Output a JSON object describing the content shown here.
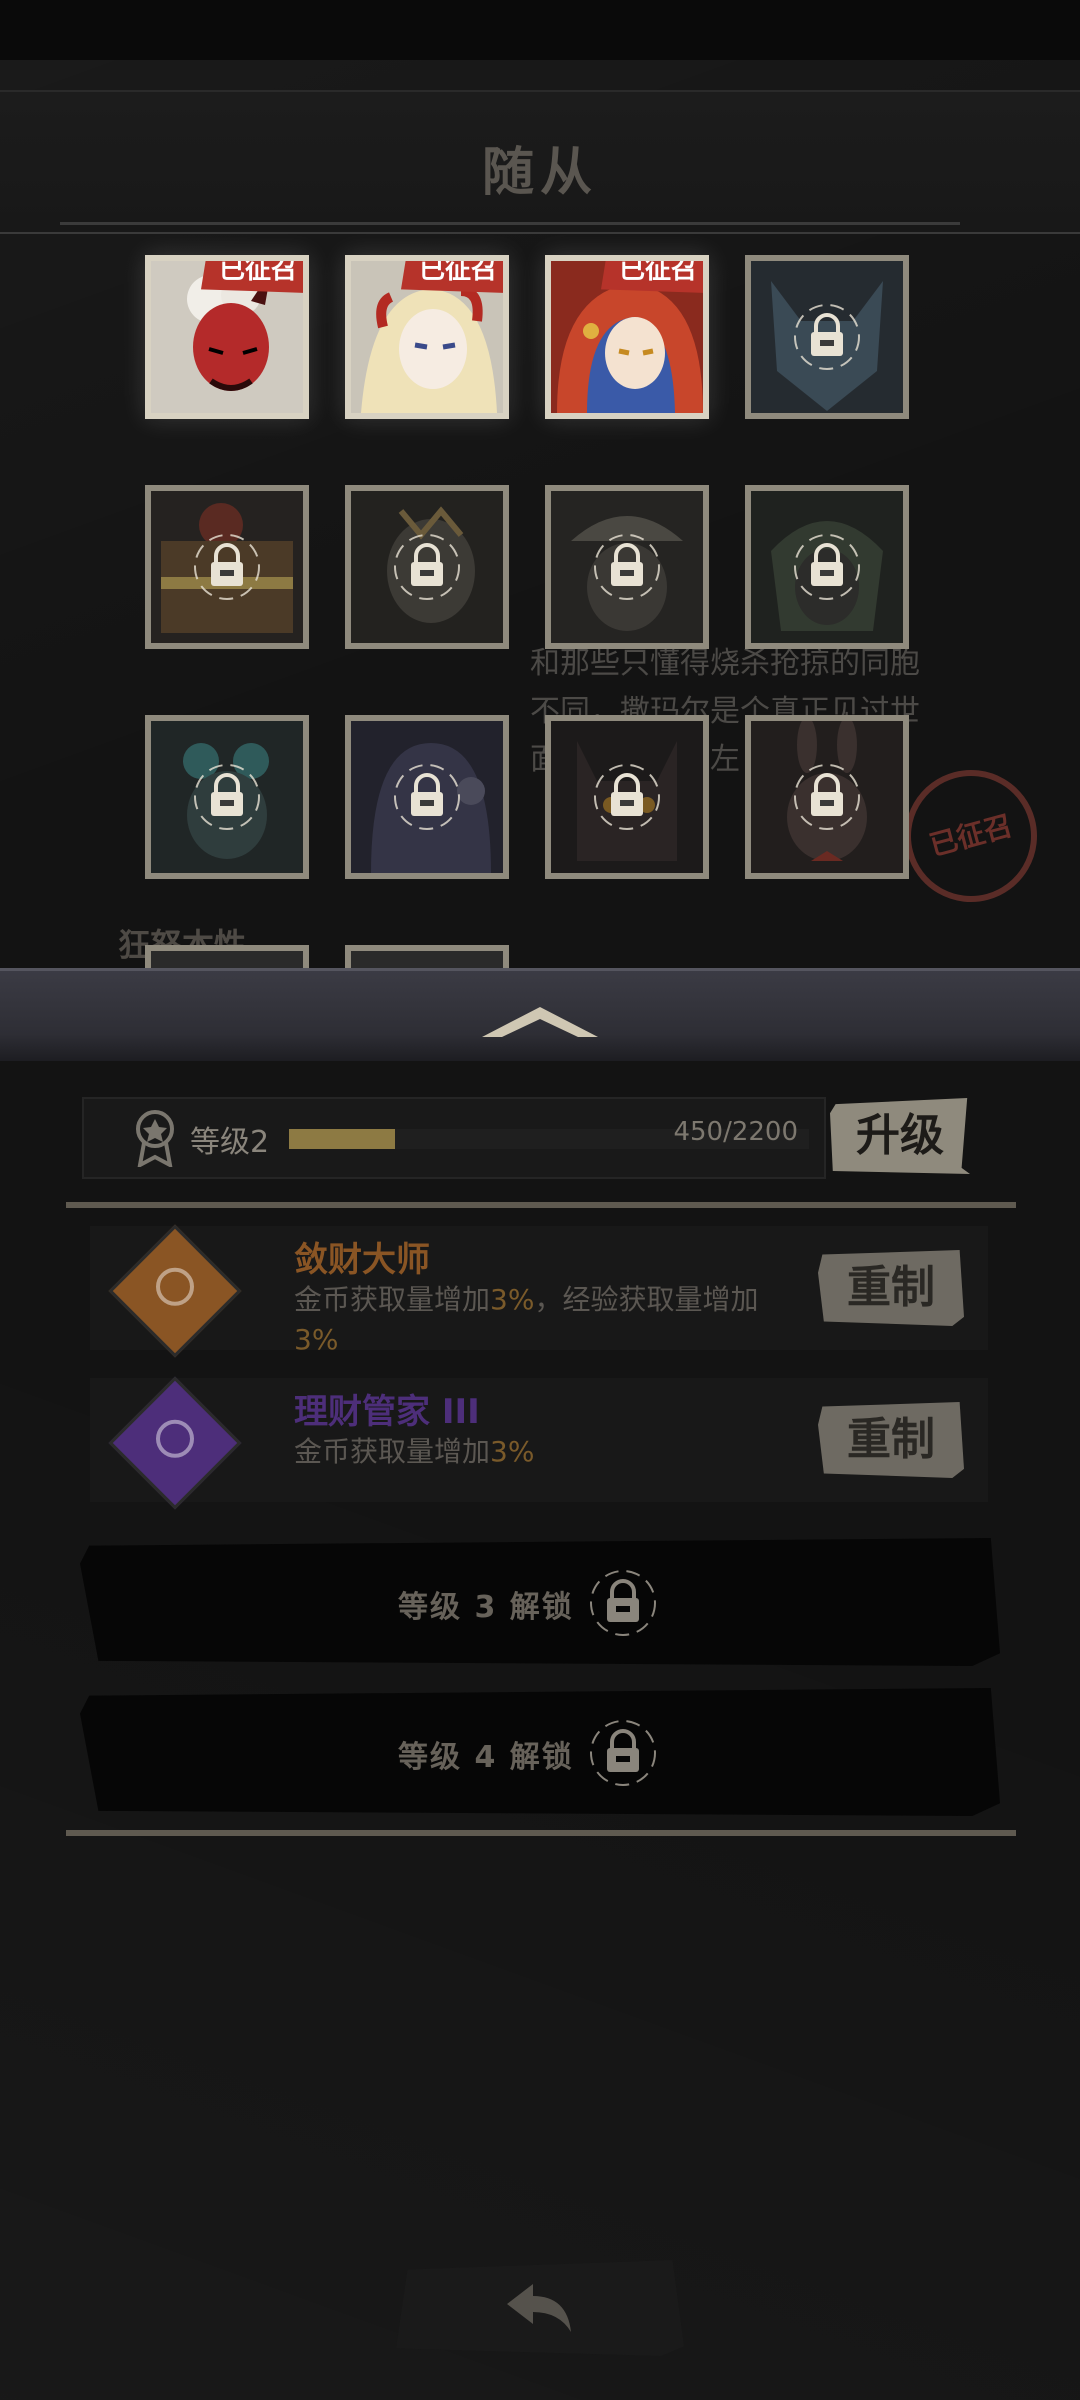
{
  "header": {
    "title": "随从"
  },
  "colors": {
    "badge": "#b6332a",
    "skill1": "#8a5524",
    "skill2": "#4d2e7a",
    "exp_fill": "#8d7a43"
  },
  "characters": [
    {
      "name": "red-demon-girl",
      "status": "已征召",
      "locked": false,
      "color": "#b42a2a"
    },
    {
      "name": "blonde-horned-girl",
      "status": "已征召",
      "locked": false,
      "color": "#e8d8b0"
    },
    {
      "name": "red-hood-girl",
      "status": "已征召",
      "locked": false,
      "color": "#c8462b"
    },
    {
      "name": "wolf",
      "locked": true,
      "color": "#3a4a55"
    },
    {
      "name": "treasure-chest",
      "locked": true,
      "color": "#4b3a27"
    },
    {
      "name": "masked-figure",
      "locked": true,
      "color": "#3c3a35"
    },
    {
      "name": "hat-figure",
      "locked": true,
      "color": "#4a4842"
    },
    {
      "name": "green-hair-figure",
      "locked": true,
      "color": "#323a30"
    },
    {
      "name": "teal-hair-girl",
      "locked": true,
      "color": "#2f3d3d"
    },
    {
      "name": "ghost-figure",
      "locked": true,
      "color": "#343446"
    },
    {
      "name": "black-cat",
      "locked": true,
      "color": "#2a2424"
    },
    {
      "name": "bunny-girl",
      "locked": true,
      "color": "#3a302e"
    }
  ],
  "background_lore": {
    "text": "和那些只懂得烧杀抢掠的同胞不同，撒玛尔是个真正见过世面的品鉴家的左",
    "stamp": "已征召",
    "section": "狂怒本性"
  },
  "level": {
    "label": "等级2",
    "exp_text": "450/2200",
    "exp_fraction": 0.2045,
    "upgrade_label": "升级"
  },
  "skills": [
    {
      "name": "敛财大师",
      "desc_prefix": "金币获取量增加",
      "desc_value1": "3%",
      "desc_mid": "，经验获取量增加",
      "desc_value2": "3%",
      "reset_label": "重制",
      "icon": "coin-book-icon"
    },
    {
      "name": "理财管家 III",
      "desc_prefix": "金币获取量增加",
      "desc_value1": "3%",
      "reset_label": "重制",
      "icon": "coin-crest-icon"
    }
  ],
  "locked_slots": [
    {
      "label": "等级 3 解锁"
    },
    {
      "label": "等级 4 解锁"
    }
  ],
  "footer": {
    "back_icon": "back-arrow-icon"
  }
}
